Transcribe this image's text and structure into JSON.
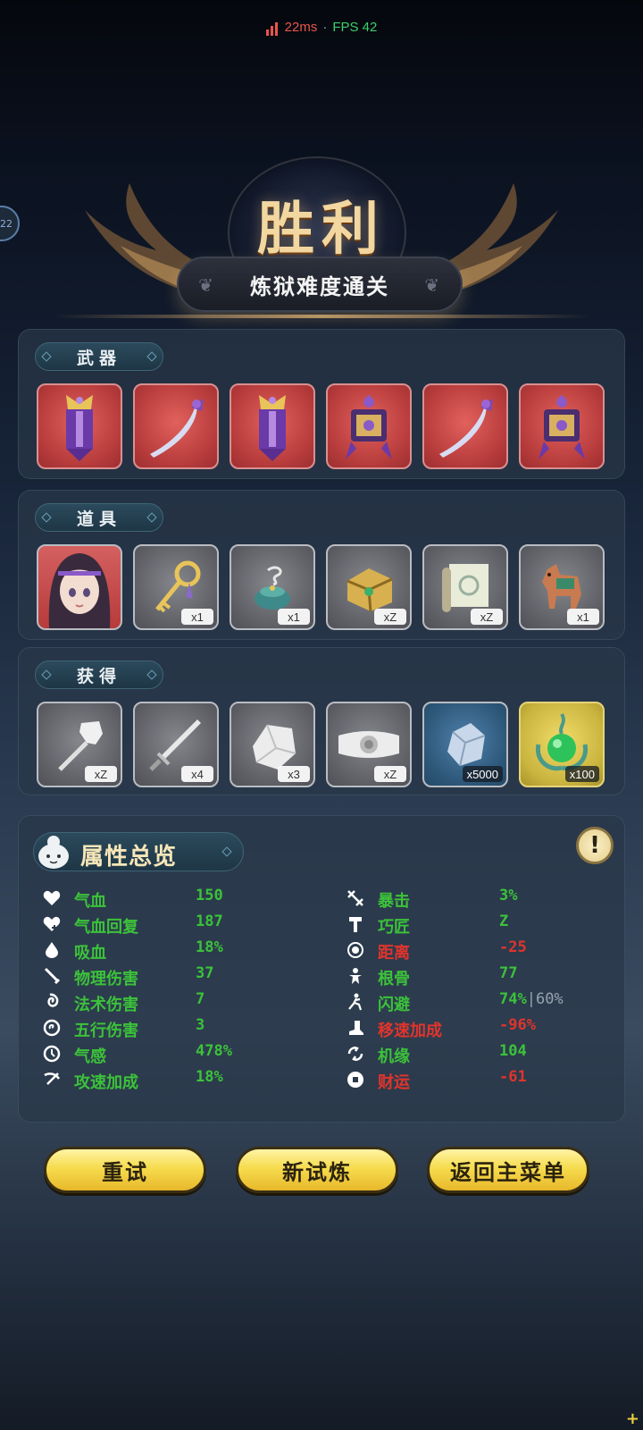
{
  "status": {
    "ping": "22ms",
    "separator": "·",
    "fps": "FPS 42"
  },
  "side_badge": "22",
  "victory": {
    "title": "胜利",
    "subtitle": "炼狱难度通关"
  },
  "sections": {
    "weapons": {
      "label": "武器",
      "items": [
        {
          "icon": "purple-banner-icon",
          "bg": "red"
        },
        {
          "icon": "curved-blade-icon",
          "bg": "red"
        },
        {
          "icon": "purple-banner-icon",
          "bg": "red"
        },
        {
          "icon": "lantern-shrine-icon",
          "bg": "red"
        },
        {
          "icon": "curved-blade-icon",
          "bg": "red"
        },
        {
          "icon": "lantern-shrine-icon",
          "bg": "red"
        }
      ]
    },
    "props": {
      "label": "道具",
      "items": [
        {
          "icon": "character-portrait-icon",
          "bg": "portrait",
          "qty": ""
        },
        {
          "icon": "golden-key-icon",
          "bg": "gray",
          "qty": "x1"
        },
        {
          "icon": "incense-burner-icon",
          "bg": "gray",
          "qty": "x1"
        },
        {
          "icon": "treasure-chest-icon",
          "bg": "gray",
          "qty": "xZ"
        },
        {
          "icon": "scroll-map-icon",
          "bg": "gray",
          "qty": "xZ"
        },
        {
          "icon": "horse-figurine-icon",
          "bg": "gray",
          "qty": "x1"
        }
      ]
    },
    "obtained": {
      "label": "获得",
      "items": [
        {
          "icon": "hammer-icon",
          "bg": "gray",
          "qty": "xZ"
        },
        {
          "icon": "sword-icon",
          "bg": "gray",
          "qty": "x4"
        },
        {
          "icon": "stone-chunk-icon",
          "bg": "gray",
          "qty": "x3"
        },
        {
          "icon": "silver-belt-icon",
          "bg": "gray",
          "qty": "xZ"
        },
        {
          "icon": "crystal-icon",
          "bg": "blue",
          "qty": "x5000"
        },
        {
          "icon": "jade-orb-icon",
          "bg": "gold",
          "qty": "x100"
        }
      ]
    }
  },
  "attributes": {
    "title": "属性总览",
    "info_symbol": "!",
    "left": [
      {
        "icon": "heart-icon",
        "name": "气血",
        "value": "150",
        "negative": false
      },
      {
        "icon": "heart-regen-icon",
        "name": "气血回复",
        "value": "187",
        "negative": false
      },
      {
        "icon": "blood-drop-icon",
        "name": "吸血",
        "value": "18%",
        "negative": false
      },
      {
        "icon": "sword-slash-icon",
        "name": "物理伤害",
        "value": "37",
        "negative": false
      },
      {
        "icon": "spiral-icon",
        "name": "法术伤害",
        "value": "7",
        "negative": false
      },
      {
        "icon": "five-elements-icon",
        "name": "五行伤害",
        "value": "3",
        "negative": false
      },
      {
        "icon": "sense-icon",
        "name": "气感",
        "value": "478%",
        "negative": false
      },
      {
        "icon": "attack-speed-icon",
        "name": "攻速加成",
        "value": "18%",
        "negative": false
      }
    ],
    "right": [
      {
        "icon": "crit-icon",
        "name": "暴击",
        "value": "3%",
        "negative": false,
        "extra": ""
      },
      {
        "icon": "hammer-craft-icon",
        "name": "巧匠",
        "value": "Z",
        "negative": false,
        "extra": ""
      },
      {
        "icon": "target-icon",
        "name": "距离",
        "value": "-25",
        "negative": true,
        "extra": ""
      },
      {
        "icon": "figure-icon",
        "name": "根骨",
        "value": "77",
        "negative": false,
        "extra": ""
      },
      {
        "icon": "dodge-icon",
        "name": "闪避",
        "value": "74%",
        "negative": false,
        "extra": "|60%"
      },
      {
        "icon": "boot-icon",
        "name": "移速加成",
        "value": "-96%",
        "negative": true,
        "extra": ""
      },
      {
        "icon": "luck-swirl-icon",
        "name": "机缘",
        "value": "104",
        "negative": false,
        "extra": ""
      },
      {
        "icon": "coin-icon",
        "name": "财运",
        "value": "-61",
        "negative": true,
        "extra": ""
      }
    ]
  },
  "buttons": {
    "retry": "重试",
    "new_trial": "新试炼",
    "main_menu": "返回主菜单"
  },
  "colors": {
    "positive": "#3cc23a",
    "negative": "#e0342c",
    "button": "#f6dc4e"
  }
}
